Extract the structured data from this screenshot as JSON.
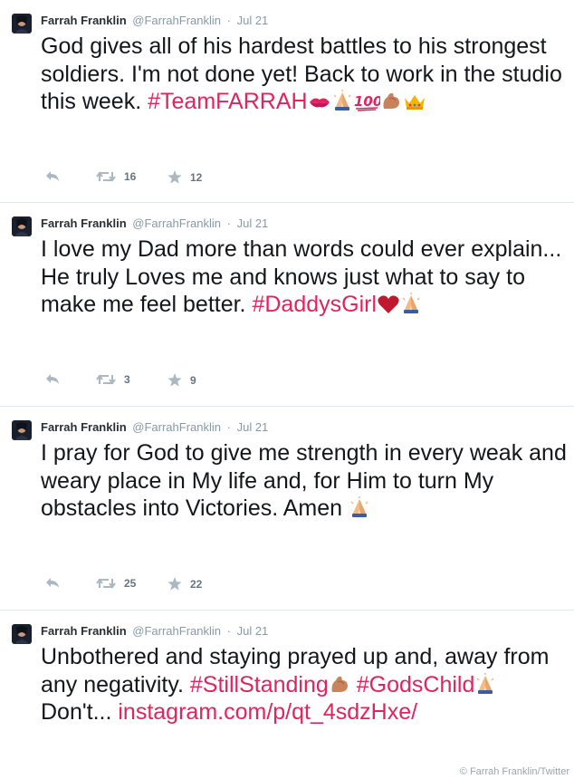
{
  "tweets": [
    {
      "author_name": "Farrah Franklin",
      "handle": "@FarrahFranklin",
      "separator": "·",
      "date": "Jul 21",
      "text_before": "God gives all of his hardest battles to his strongest soldiers. I'm not done yet! Back to work in the studio this week. ",
      "hashtag": "#TeamFARRAH",
      "emojis": [
        "kiss-mark",
        "folded-hands",
        "hundred-points",
        "flexed-biceps",
        "crown"
      ],
      "retweet_count": "16",
      "favorite_count": "12"
    },
    {
      "author_name": "Farrah Franklin",
      "handle": "@FarrahFranklin",
      "separator": "·",
      "date": "Jul 21",
      "text_before": "I love my Dad more than words could ever explain... He truly Loves me and knows just what to say to make me feel better. ",
      "hashtag": "#DaddysGirl",
      "emojis": [
        "red-heart",
        "folded-hands"
      ],
      "retweet_count": "3",
      "favorite_count": "9"
    },
    {
      "author_name": "Farrah Franklin",
      "handle": "@FarrahFranklin",
      "separator": "·",
      "date": "Jul 21",
      "text_before": "I pray for God to give me strength in every weak and weary place in My life and, for Him to turn My obstacles into Victories. Amen ",
      "emojis": [
        "folded-hands"
      ],
      "retweet_count": "25",
      "favorite_count": "22"
    },
    {
      "author_name": "Farrah Franklin",
      "handle": "@FarrahFranklin",
      "separator": "·",
      "date": "Jul 21",
      "text_before": "Unbothered and staying prayed up and, away from any negativity. ",
      "hashtag_1": "#StillStanding",
      "hashtag_2": "#GodsChild",
      "text_middle": " Don't... ",
      "link_text": "instagram.com/p/qt_4sdzHxe/"
    }
  ],
  "image_credit": "© Farrah Franklin/Twitter",
  "colors": {
    "hashtag": "#e0245e",
    "meta_text": "#8899a6",
    "divider": "#e1e8ed"
  },
  "icons": {
    "reply": "reply-icon",
    "retweet": "retweet-icon",
    "favorite": "star-icon"
  }
}
